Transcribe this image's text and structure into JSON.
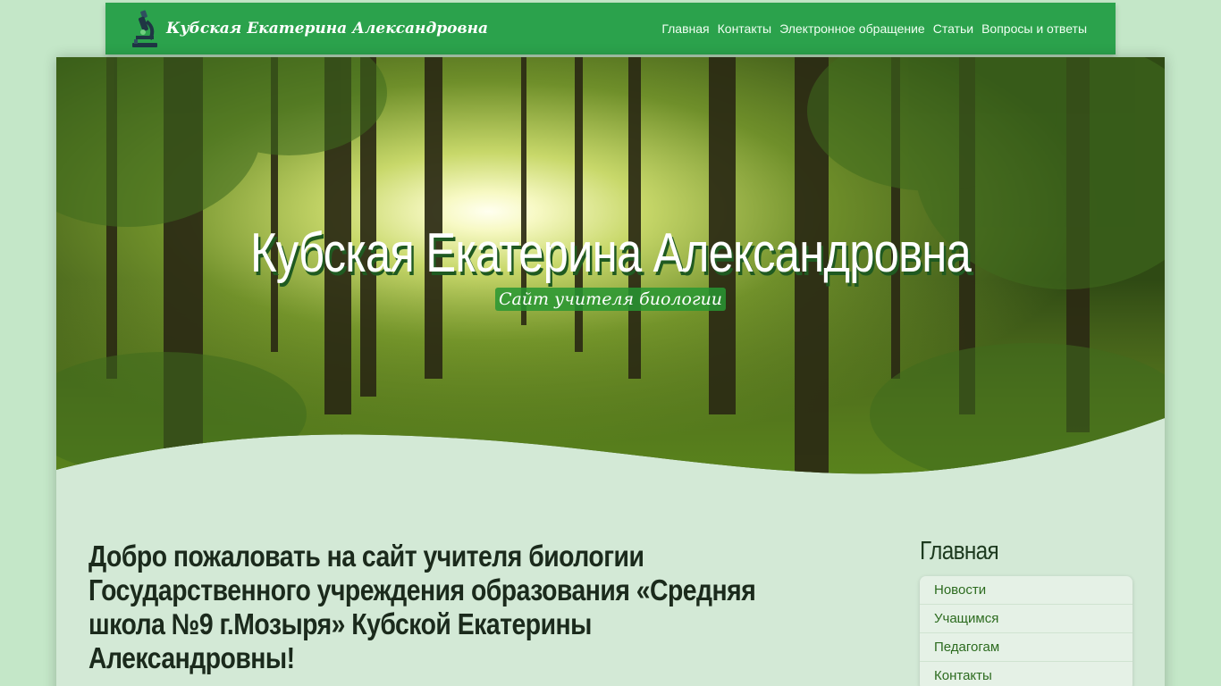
{
  "header": {
    "brand": "Кубская Екатерина Александровна",
    "logo_icon": "microscope-icon",
    "nav": [
      "Главная",
      "Контакты",
      "Электронное обращение",
      "Статьи",
      "Вопросы и ответы"
    ]
  },
  "hero": {
    "title": "Кубская Екатерина Александровна",
    "subtitle": "Сайт учителя биологии"
  },
  "main": {
    "welcome": "Добро пожаловать на сайт учителя биологии Государственного учреждения образования «Средняя школа №9 г.Мозыря» Кубской Екатерины Александровны!"
  },
  "sidebar": {
    "title": "Главная",
    "items": [
      "Новости",
      "Учащимся",
      "Педагогам",
      "Контакты"
    ]
  },
  "colors": {
    "page_bg": "#c4e7c8",
    "nav_bg": "#2ba24c",
    "card_bg": "#d3e9d6"
  }
}
